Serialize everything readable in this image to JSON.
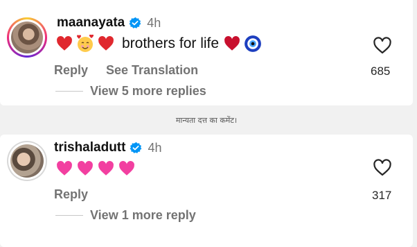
{
  "comments": [
    {
      "username": "maanayata",
      "time": "4h",
      "text": "brothers for life",
      "emojis_before": [
        "red-heart",
        "smiling-face-with-hearts",
        "red-heart"
      ],
      "emojis_after": [
        "red-heart",
        "nazar-amulet"
      ],
      "reply_label": "Reply",
      "translate_label": "See Translation",
      "likes": "685",
      "view_replies": "View 5 more replies"
    },
    {
      "username": "trishaladutt",
      "time": "4h",
      "emojis": [
        "pink-heart",
        "pink-heart",
        "pink-heart",
        "pink-heart"
      ],
      "reply_label": "Reply",
      "likes": "317",
      "view_replies": "View 1 more reply"
    }
  ],
  "caption": "मान्यता दत्त का कमेंट।",
  "colors": {
    "background": "#f1f1f1",
    "card": "#ffffff",
    "verified_blue": "#0095f6",
    "red_heart": "#e0282e",
    "pink_heart": "#f23fa0",
    "secondary_text": "#737373"
  }
}
